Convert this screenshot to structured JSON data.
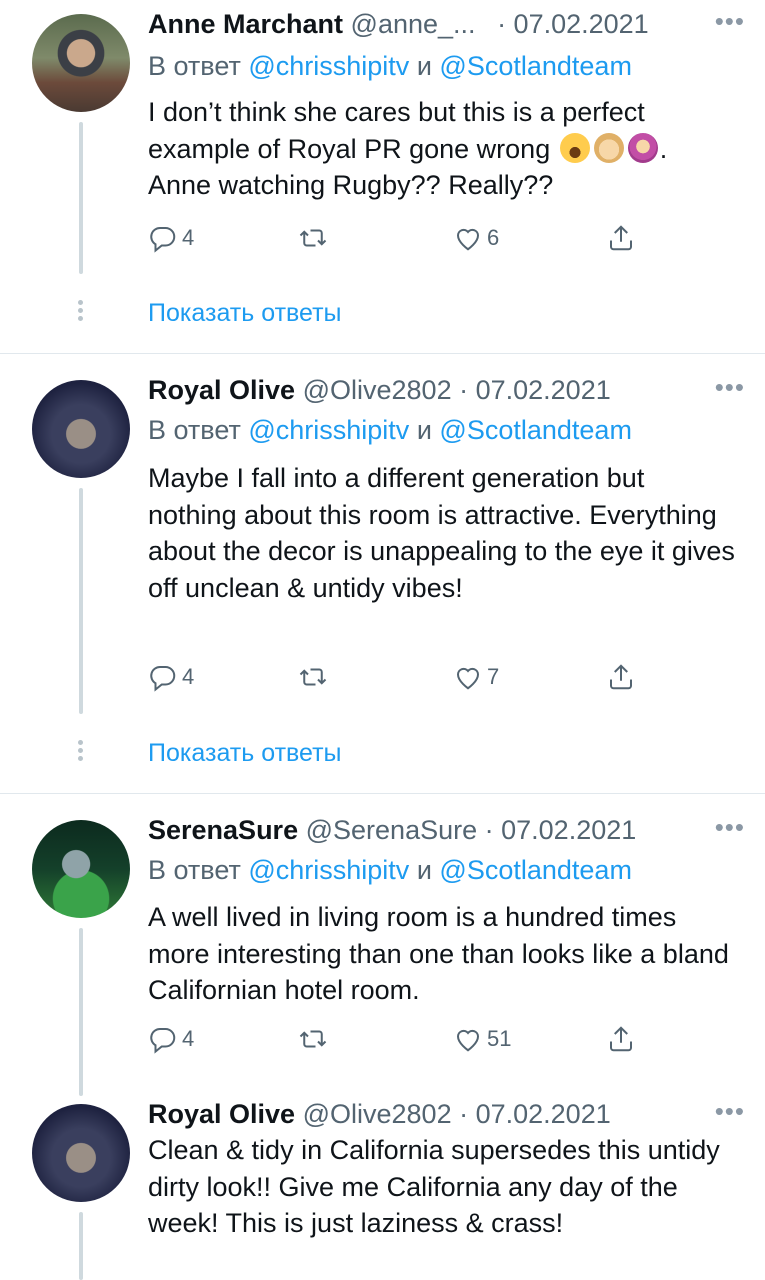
{
  "colors": {
    "link": "#1d9bf0",
    "secondary": "#536471",
    "thread_line": "#cfd9de"
  },
  "icons": {
    "reply": "reply-icon",
    "retweet": "retweet-icon",
    "like": "heart-icon",
    "share": "share-icon",
    "more": "more-icon"
  },
  "reply_to": {
    "prefix": "В ответ",
    "first": "@chrisshipitv",
    "conj": "и",
    "second": "@Scotlandteam"
  },
  "show_replies_label": "Показать ответы",
  "more_glyph": "•••",
  "tweets": [
    {
      "name": "Anne Marchant",
      "handle": "@anne_...",
      "date": "· 07.02.2021",
      "text_line1": "I don’t think she cares but this is a perfect",
      "text_line2": "example of Royal PR gone wrong",
      "text_line2_end": ".",
      "text_line3": "Anne watching Rugby??  Really??",
      "emojis": [
        "face-with-tears-of-joy-emoji",
        "facepalm-emoji",
        "shrug-emoji"
      ],
      "replies": "4",
      "retweets": "",
      "likes": "6"
    },
    {
      "name": "Royal Olive",
      "handle": "@Olive2802",
      "date": "· 07.02.2021",
      "text": "Maybe I fall into a different generation but nothing about this room is attractive. Everything about the decor is unappealing to the eye it gives off unclean & untidy vibes!",
      "replies": "4",
      "retweets": "",
      "likes": "7"
    },
    {
      "name": "SerenaSure",
      "handle": "@SerenaSure",
      "date": "· 07.02.2021",
      "text": "A well lived in living room is a hundred times more interesting than one than looks like a bland Californian hotel room.",
      "replies": "4",
      "retweets": "",
      "likes": "51"
    },
    {
      "name": "Royal Olive",
      "handle": "@Olive2802",
      "date": "· 07.02.2021",
      "text": "Clean & tidy in California supersedes this untidy dirty look!! Give me California any day of the week! This is just laziness & crass!"
    }
  ]
}
